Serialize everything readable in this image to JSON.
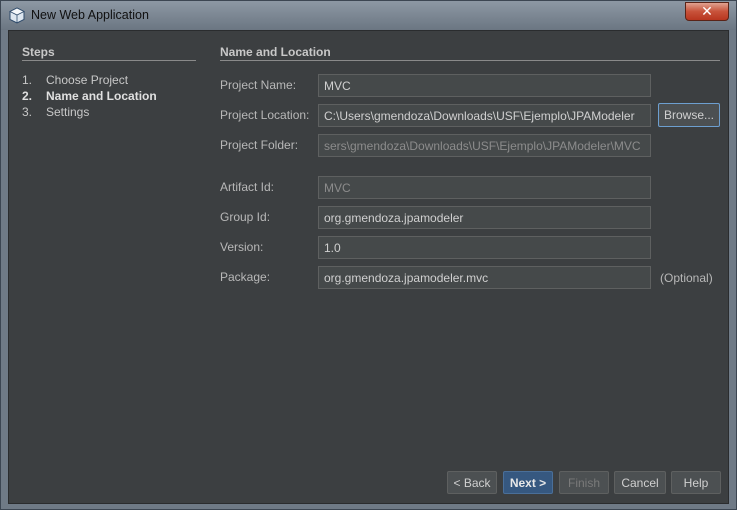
{
  "window": {
    "title": "New Web Application",
    "close_label": "✕"
  },
  "steps": {
    "title": "Steps",
    "items": [
      {
        "num": "1.",
        "label": "Choose Project"
      },
      {
        "num": "2.",
        "label": "Name and Location"
      },
      {
        "num": "3.",
        "label": "Settings"
      }
    ]
  },
  "section": {
    "title": "Name and Location"
  },
  "form": {
    "project_name": {
      "label": "Project Name:",
      "value": "MVC"
    },
    "project_location": {
      "label": "Project Location:",
      "value": "C:\\Users\\gmendoza\\Downloads\\USF\\Ejemplo\\JPAModeler",
      "browse_label": "Browse..."
    },
    "project_folder": {
      "label": "Project Folder:",
      "value": "sers\\gmendoza\\Downloads\\USF\\Ejemplo\\JPAModeler\\MVC"
    },
    "artifact_id": {
      "label": "Artifact Id:",
      "value": "MVC"
    },
    "group_id": {
      "label": "Group Id:",
      "value": "org.gmendoza.jpamodeler"
    },
    "version": {
      "label": "Version:",
      "value": "1.0"
    },
    "package": {
      "label": "Package:",
      "value": "org.gmendoza.jpamodeler.mvc",
      "optional_label": "(Optional)"
    }
  },
  "buttons": {
    "back": "< Back",
    "next": "Next >",
    "finish": "Finish",
    "cancel": "Cancel",
    "help": "Help"
  }
}
